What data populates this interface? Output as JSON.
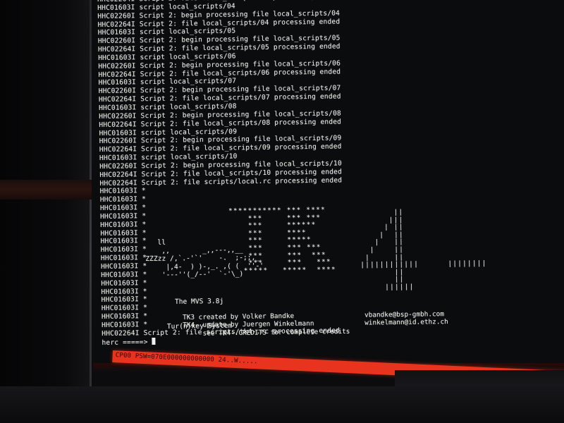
{
  "log": {
    "lines": [
      "HHC02264I Script 2: file local_scripts/03 processing ended",
      "HHC01603I script local_scripts/04",
      "HHC02260I Script 2: begin processing file local_scripts/04",
      "HHC02264I Script 2: file local_scripts/04 processing ended",
      "HHC01603I script local_scripts/05",
      "HHC02260I Script 2: begin processing file local_scripts/05",
      "HHC02264I Script 2: file local_scripts/05 processing ended",
      "HHC01603I script local_scripts/06",
      "HHC02260I Script 2: begin processing file local_scripts/06",
      "HHC02264I Script 2: file local_scripts/06 processing ended",
      "HHC01603I script local_scripts/07",
      "HHC02260I Script 2: begin processing file local_scripts/07",
      "HHC02264I Script 2: file local_scripts/07 processing ended",
      "HHC01603I script local_scripts/08",
      "HHC02260I Script 2: begin processing file local_scripts/08",
      "HHC02264I Script 2: file local_scripts/08 processing ended",
      "HHC01603I script local_scripts/09",
      "HHC02260I Script 2: begin processing file local_scripts/09",
      "HHC02264I Script 2: file local_scripts/09 processing ended",
      "HHC01603I script local_scripts/10",
      "HHC02260I Script 2: begin processing file local_scripts/10",
      "HHC02264I Script 2: file local_scripts/10 processing ended",
      "HHC02264I Script 2: file scripts/local.rc processing ended",
      "HHC01603I *",
      "HHC01603I *",
      "HHC01603I *",
      "HHC01603I *",
      "HHC01603I *",
      "HHC01603I *",
      "HHC01603I *",
      "HHC01603I *",
      "HHC01603I *",
      "HHC01603I *",
      "HHC01603I *",
      "HHC01603I *",
      "HHC01603I *",
      "HHC01603I *",
      "HHC01603I *",
      "HHC01603I *",
      "HHC01603I *",
      "HHC02264I Script 2: file scripts/tk4-.rc processing ended"
    ],
    "prompt": "herc =====>"
  },
  "banner": {
    "car_art": "   ll\n    ,,        _,,---,,__\nZZZzz /,`.-'`'    -.  ;-;;,_\n     |,4-  ) )-,_. ,( (  ''-'\n    '---''(_/--'  `-'\\_)",
    "tk3_art": "*********** *** ****\n    ***     *** ***\n    ***     ******\n    ***     ****\n    ***     *****\n    ***     *** ***\n    ***     ***  ***\n    ***     ***   ***\n   *****   *****  ****",
    "tk4_art": "              ||\n             |||\n            | ||\n           |  ||\n          |   ||\n         |    ||\n        |     ||\n       ||||||||||||      ||||||||\n              ||\n              ||\n            ||||||",
    "mvs_line": "The MVS 3.8j",
    "system_line": "Tur(n)key System",
    "credits": [
      {
        "left": "TK3 created by Volker Bandke",
        "right": "vbandke@bsp-gmbh.com"
      },
      {
        "left": "TK4- update by Juergen Winkelmann",
        "right": "winkelmann@id.ethz.ch"
      },
      {
        "left": "     see TK4-.CREDITS for complete credits",
        "right": ""
      }
    ]
  },
  "status_bar": {
    "text": "CP00 PSW=070E000000000000 24..W.....",
    "color": "#e8331f"
  }
}
